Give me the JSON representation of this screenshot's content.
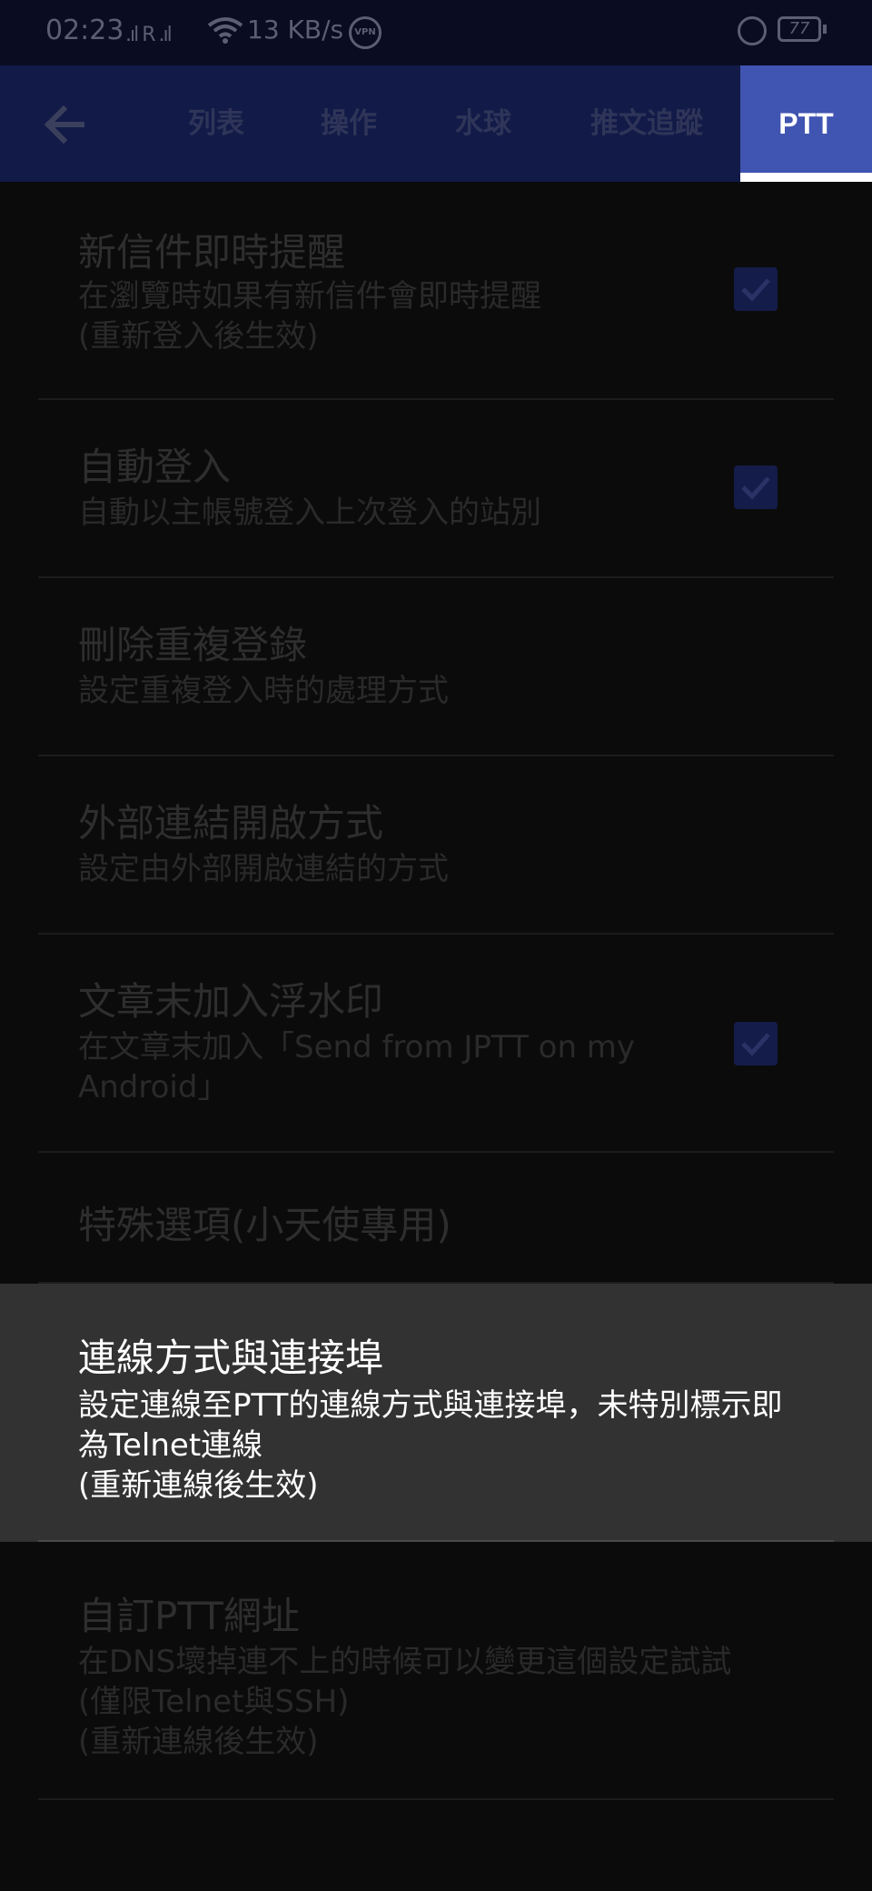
{
  "status": {
    "time": "02:23",
    "signal": ".ıl R .ıl",
    "speed": "13 KB/s",
    "vpn": "VPN",
    "battery": "77"
  },
  "toolbar": {
    "tabs": [
      {
        "label": "列表"
      },
      {
        "label": "操作"
      },
      {
        "label": "水球"
      },
      {
        "label": "推文追蹤"
      },
      {
        "label": "PTT"
      }
    ],
    "active_tab": "PTT"
  },
  "settings": [
    {
      "title": "新信件即時提醒",
      "summary": "在瀏覽時如果有新信件會即時提醒\n(重新登入後生效)",
      "checked": true
    },
    {
      "title": "自動登入",
      "summary": "自動以主帳號登入上次登入的站別",
      "checked": true
    },
    {
      "title": "刪除重複登錄",
      "summary": "設定重複登入時的處理方式"
    },
    {
      "title": "外部連結開啟方式",
      "summary": "設定由外部開啟連結的方式"
    },
    {
      "title": "文章末加入浮水印",
      "summary": "在文章末加入「Send from JPTT on my Android」",
      "checked": true
    },
    {
      "title": "特殊選項(小天使專用)",
      "summary": ""
    },
    {
      "title": "連線方式與連接埠",
      "summary": "設定連線至PTT的連線方式與連接埠，未特別標示即為Telnet連線\n(重新連線後生效)",
      "highlighted": true
    },
    {
      "title": "自訂PTT網址",
      "summary": "在DNS壞掉連不上的時候可以變更這個設定試試\n(僅限Telnet與SSH)\n(重新連線後生效)"
    }
  ]
}
